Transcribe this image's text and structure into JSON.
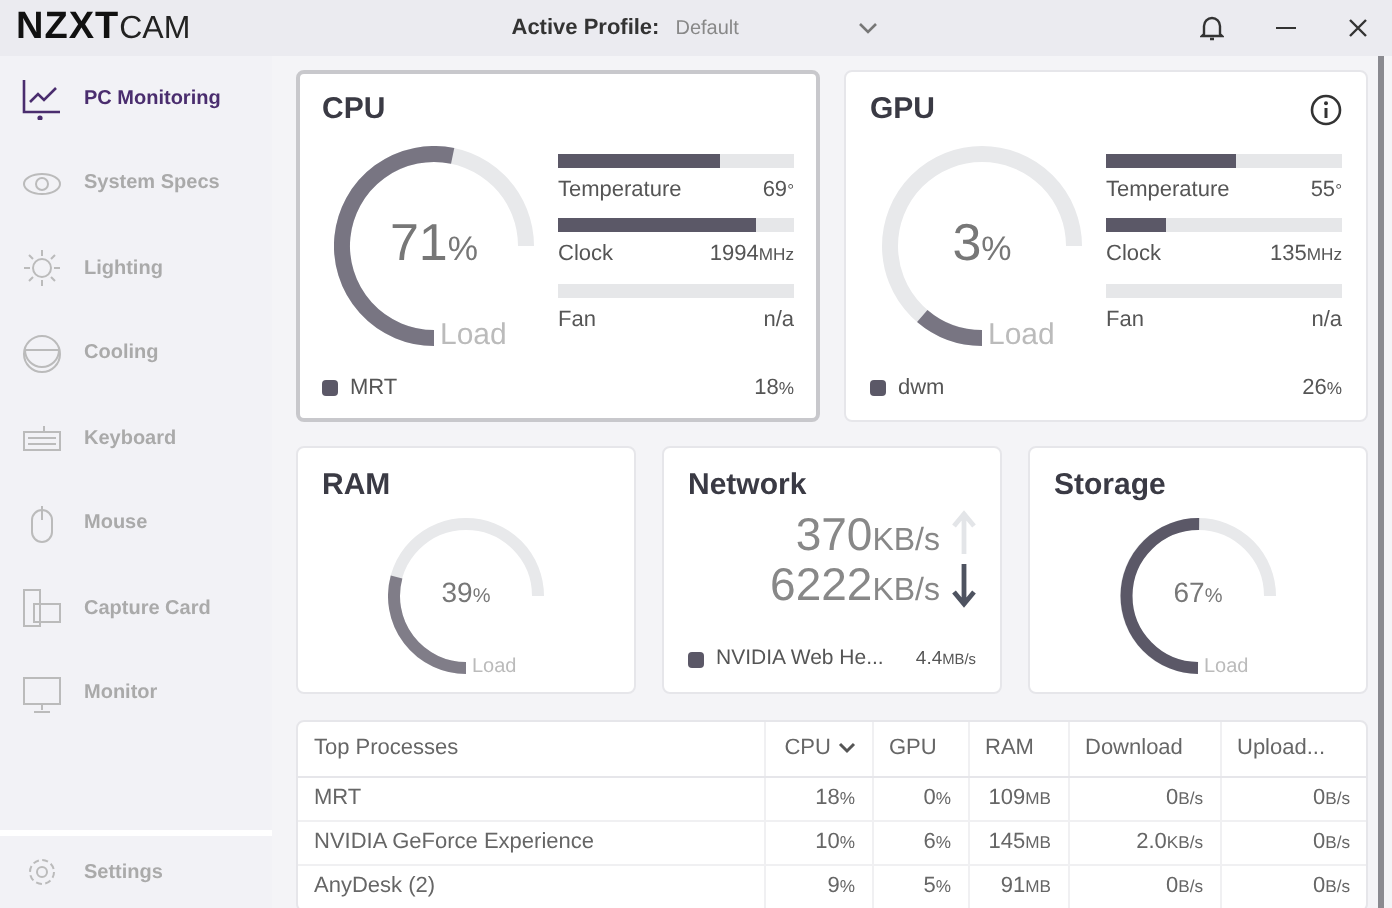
{
  "app": {
    "brand": "NZXT",
    "product": "CAM"
  },
  "profile": {
    "label": "Active Profile:",
    "value": "Default"
  },
  "sidebar": {
    "items": [
      {
        "label": "PC Monitoring",
        "selected": true
      },
      {
        "label": "System Specs",
        "selected": false
      },
      {
        "label": "Lighting",
        "selected": false
      },
      {
        "label": "Cooling",
        "selected": false
      },
      {
        "label": "Keyboard",
        "selected": false
      },
      {
        "label": "Mouse",
        "selected": false
      },
      {
        "label": "Capture Card",
        "selected": false
      },
      {
        "label": "Monitor",
        "selected": false
      }
    ],
    "settings": {
      "label": "Settings",
      "selected": false
    }
  },
  "processors": [
    {
      "title": "CPU",
      "selected": true,
      "info": false,
      "gauge": {
        "value": "71",
        "unit": "%",
        "label": "Load"
      },
      "metrics": [
        {
          "label": "Temperature",
          "value": "69",
          "unit": "°",
          "level": 0.69
        },
        {
          "label": "Clock",
          "value": "1994",
          "unit": "MHz",
          "level": 0.84
        },
        {
          "label": "Fan",
          "value": "n/a",
          "level": 0
        }
      ],
      "top_process": {
        "name": "MRT",
        "value": "18",
        "unit": "%"
      }
    },
    {
      "title": "GPU",
      "selected": false,
      "info": true,
      "gauge": {
        "value": "3",
        "unit": "%",
        "label": "Load"
      },
      "metrics": [
        {
          "label": "Temperature",
          "value": "55",
          "unit": "°",
          "level": 0.55
        },
        {
          "label": "Clock",
          "value": "135",
          "unit": "MHz",
          "level": 0.25
        },
        {
          "label": "Fan",
          "value": "n/a",
          "level": 0
        }
      ],
      "top_process": {
        "name": "dwm",
        "value": "26",
        "unit": "%"
      }
    }
  ],
  "ram": {
    "title": "RAM",
    "gauge": {
      "value": "39",
      "unit": "%",
      "label": "Load"
    }
  },
  "network": {
    "title": "Network",
    "rates": [
      {
        "value": "370",
        "unit": "KB/s",
        "kind": "up",
        "active": false
      },
      {
        "value": "6222",
        "unit": "KB/s",
        "kind": "down",
        "active": true
      }
    ],
    "top_process": {
      "name": "NVIDIA Web He...",
      "value": "4.4",
      "unit": "MB/s"
    }
  },
  "storage": {
    "title": "Storage",
    "gauge": {
      "value": "67",
      "unit": "%",
      "label": "Load"
    }
  },
  "table": {
    "columns": [
      {
        "label": "Top Processes",
        "sorted": false
      },
      {
        "label": "CPU",
        "sorted": true
      },
      {
        "label": "GPU",
        "sorted": false
      },
      {
        "label": "RAM",
        "sorted": false
      },
      {
        "label": "Download",
        "sorted": false
      },
      {
        "label": "Upload...",
        "sorted": false
      }
    ],
    "rows": [
      {
        "cells": [
          [
            "MRT"
          ],
          [
            "18",
            "%"
          ],
          [
            "0",
            "%"
          ],
          [
            "109",
            "MB"
          ],
          [
            "0",
            "B/s"
          ],
          [
            "0",
            "B/s"
          ]
        ]
      },
      {
        "cells": [
          [
            "NVIDIA GeForce Experience"
          ],
          [
            "10",
            "%"
          ],
          [
            "6",
            "%"
          ],
          [
            "145",
            "MB"
          ],
          [
            "2.0",
            "KB/s"
          ],
          [
            "0",
            "B/s"
          ]
        ]
      },
      {
        "cells": [
          [
            "AnyDesk (2)"
          ],
          [
            "9",
            "%"
          ],
          [
            "5",
            "%"
          ],
          [
            "91",
            "MB"
          ],
          [
            "0",
            "B/s"
          ],
          [
            "0",
            "B/s"
          ]
        ]
      }
    ]
  }
}
